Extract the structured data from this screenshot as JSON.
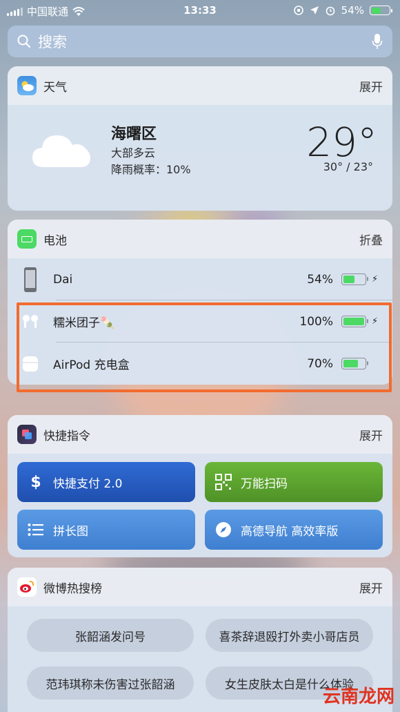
{
  "status_bar": {
    "carrier": "中国联通",
    "time": "13:33",
    "battery_pct": "54%",
    "battery_level": 0.54
  },
  "search": {
    "placeholder": "搜索"
  },
  "weather": {
    "app_name": "天气",
    "action": "展开",
    "location": "海曙区",
    "condition": "大部多云",
    "rain_prob": "降雨概率：10%",
    "temperature": "29°",
    "range": "30° / 23°"
  },
  "battery_widget": {
    "app_name": "电池",
    "action": "折叠",
    "devices": [
      {
        "name": "Dai",
        "pct": "54%",
        "level": 0.54,
        "charging": true,
        "icon": "iphone-icon"
      },
      {
        "name": "糯米团子🍡",
        "pct": "100%",
        "level": 1.0,
        "charging": true,
        "icon": "airpods-icon"
      },
      {
        "name": "AirPod 充电盒",
        "pct": "70%",
        "level": 0.7,
        "charging": false,
        "icon": "airpods-case-icon"
      }
    ]
  },
  "shortcuts": {
    "app_name": "快捷指令",
    "action": "展开",
    "items": [
      {
        "label": "快捷支付 2.0",
        "icon": "dollar-icon",
        "color": "#2f5fc4"
      },
      {
        "label": "万能扫码",
        "icon": "qr-code-icon",
        "color": "#5aa02c"
      },
      {
        "label": "拼长图",
        "icon": "list-icon",
        "color": "#4a86d6"
      },
      {
        "label": "高德导航 高效率版",
        "icon": "compass-icon",
        "color": "#4a86d6"
      }
    ]
  },
  "weibo": {
    "app_name": "微博热搜榜",
    "action": "展开",
    "topics": [
      "张韶涵发问号",
      "喜茶辞退殴打外卖小哥店员",
      "范玮琪称未伤害过张韶涵",
      "女生皮肤太白是什么体验"
    ]
  },
  "watermark": {
    "text": "云南龙网"
  }
}
